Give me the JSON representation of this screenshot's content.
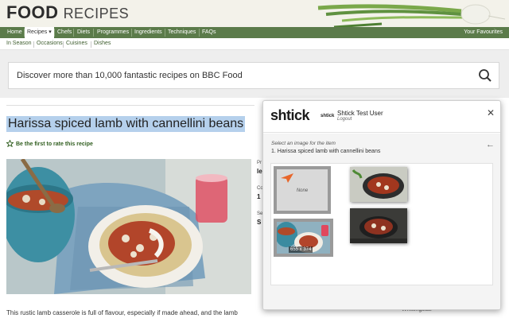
{
  "header": {
    "brand_primary": "FOOD",
    "brand_secondary": "RECIPES"
  },
  "nav": {
    "items": [
      {
        "label": "Home"
      },
      {
        "label": "Recipes ▾",
        "active": true
      },
      {
        "label": "Chefs"
      },
      {
        "label": "Diets"
      },
      {
        "label": "Programmes"
      },
      {
        "label": "Ingredients"
      },
      {
        "label": "Techniques"
      },
      {
        "label": "FAQs"
      }
    ],
    "favourites": "Your Favourites"
  },
  "subnav": {
    "items": [
      "In Season",
      "Occasions",
      "Cuisines",
      "Dishes"
    ]
  },
  "search": {
    "placeholder": "Discover more than 10,000 fantastic recipes on BBC Food"
  },
  "recipe": {
    "title": "Harissa spiced lamb with cannellini beans",
    "rate_label": "Be the first to rate this recipe",
    "side_labels": [
      "Pr",
      "Co",
      "Se"
    ],
    "side_values": [
      "le",
      "1",
      "S"
    ],
    "intro": "This rustic lamb casserole is full of flavour, especially if made ahead, and the lamb",
    "bottom_right_text": "Whittingstall"
  },
  "shtick": {
    "logo": "shtick",
    "mini_logo": "shtick",
    "user": "Shtick Test User",
    "logout": "Logout",
    "prompt": "Select an image for the item",
    "item": "1. Harissa spiced lamb with cannellini beans",
    "none_label": "None",
    "thumb_dims": "655 x 374"
  },
  "colors": {
    "nav_bg": "#5b7b4a",
    "highlight": "#b5d0ec",
    "accent_orange": "#e8662a"
  }
}
